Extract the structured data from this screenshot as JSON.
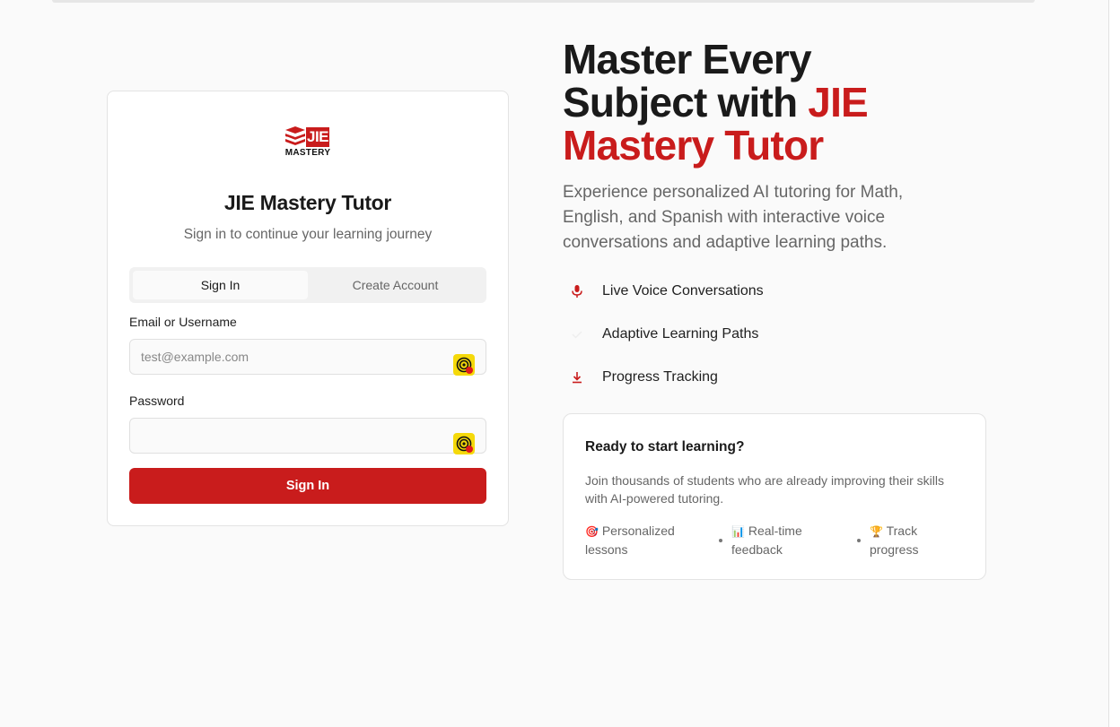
{
  "login_card": {
    "logo_text": "JIE",
    "logo_subtext": "MASTERY",
    "title": "JIE Mastery Tutor",
    "subtitle": "Sign in to continue your learning journey",
    "tabs": [
      {
        "label": "Sign In",
        "active": true
      },
      {
        "label": "Create Account",
        "active": false
      }
    ],
    "email_label": "Email or Username",
    "email_placeholder": "test@example.com",
    "email_value": "",
    "password_label": "Password",
    "password_value": "",
    "submit_label": "Sign In"
  },
  "hero": {
    "title_line1": "Master Every",
    "title_line2_prefix": "Subject with ",
    "title_accent_1": "JIE",
    "title_accent_2": "Mastery Tutor",
    "description": "Experience personalized AI tutoring for Math, English, and Spanish with interactive voice conversations and adaptive learning paths.",
    "features": [
      {
        "icon": "microphone-icon",
        "label": "Live Voice Conversations"
      },
      {
        "icon": "check-icon",
        "label": "Adaptive Learning Paths"
      },
      {
        "icon": "download-icon",
        "label": "Progress Tracking"
      }
    ]
  },
  "cta": {
    "title": "Ready to start learning?",
    "body": "Join thousands of students who are already improving their skills with AI-powered tutoring.",
    "items": [
      {
        "emoji": "🎯",
        "line1": "Personalized",
        "line2": "lessons"
      },
      {
        "emoji": "📊",
        "line1": "Real-time",
        "line2": "feedback"
      },
      {
        "emoji": "🏆",
        "line1": "Track",
        "line2": "progress"
      }
    ]
  },
  "colors": {
    "accent": "#c91c1c",
    "background": "#fafafa",
    "text": "#1a1a1a",
    "muted": "#666666"
  }
}
